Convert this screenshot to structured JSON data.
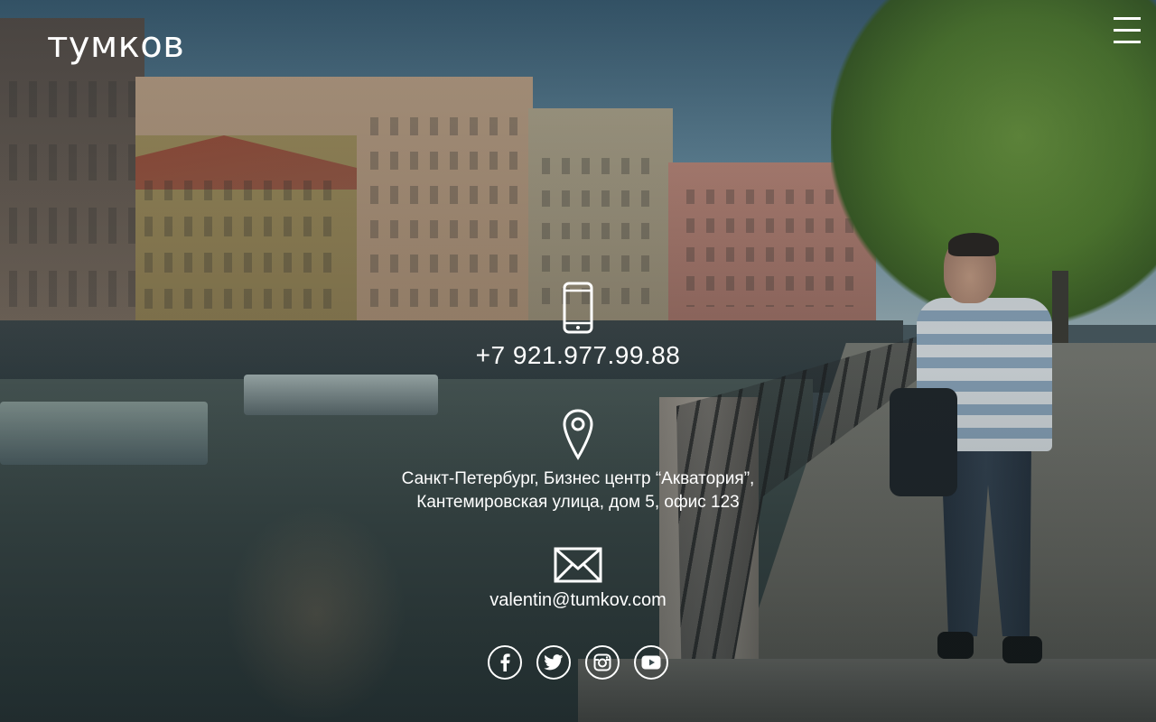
{
  "header": {
    "logo_text": "тумков",
    "menu_icon": "hamburger-menu-icon"
  },
  "contacts": {
    "phone": {
      "icon": "smartphone-icon",
      "text": "+7 921.977.99.88"
    },
    "address": {
      "icon": "location-pin-icon",
      "line1": "Санкт-Петербург, Бизнес центр “Акватория”,",
      "line2": "Кантемировская улица, дом 5, офис 123"
    },
    "email": {
      "icon": "envelope-icon",
      "text": "valentin@tumkov.com"
    }
  },
  "social": [
    {
      "name": "facebook",
      "icon": "facebook-icon"
    },
    {
      "name": "twitter",
      "icon": "twitter-icon"
    },
    {
      "name": "instagram",
      "icon": "instagram-icon"
    },
    {
      "name": "youtube",
      "icon": "youtube-icon"
    }
  ],
  "colors": {
    "text": "#ffffff",
    "overlay": "#142830"
  }
}
